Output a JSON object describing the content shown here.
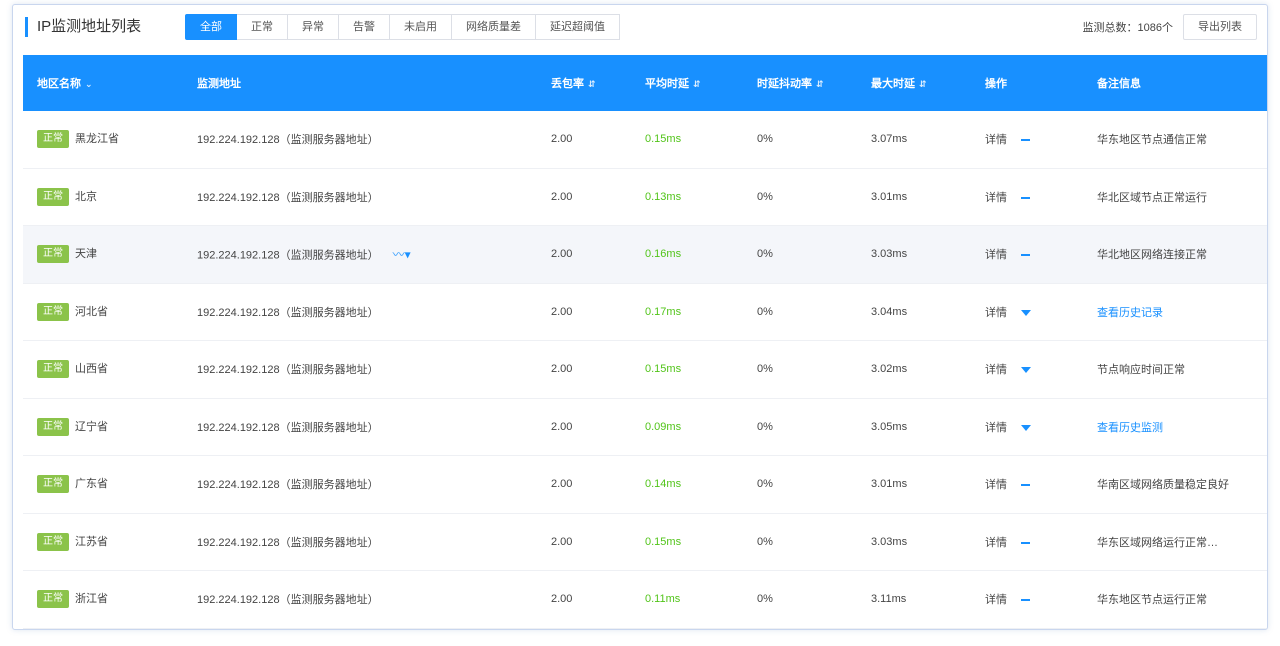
{
  "header": {
    "title": "IP监测地址列表",
    "tabs": [
      "全部",
      "正常",
      "异常",
      "告警",
      "未启用",
      "网络质量差",
      "延迟超阈值"
    ],
    "active_tab": 0,
    "right_label": "监测总数：1086个",
    "right_button": "导出列表"
  },
  "table": {
    "columns": [
      "地区名称",
      "监测地址",
      "丢包率",
      "平均时延",
      "时延抖动率",
      "最大时延",
      "操作",
      "备注信息"
    ],
    "rows": [
      {
        "tag": "正常",
        "region": "黑龙江省",
        "address": "192.224.192.128（监测服务器地址）",
        "loss": "2.00",
        "avg": "0.15ms",
        "jitter": "0%",
        "max": "3.07ms",
        "op": "详情",
        "op_icon": "dash",
        "note": "华东地区节点通信正常",
        "note_link": false,
        "chart": false
      },
      {
        "tag": "正常",
        "region": "北京",
        "address": "192.224.192.128（监测服务器地址）",
        "loss": "2.00",
        "avg": "0.13ms",
        "jitter": "0%",
        "max": "3.01ms",
        "op": "详情",
        "op_icon": "dash",
        "note": "华北区域节点正常运行",
        "note_link": false,
        "chart": false
      },
      {
        "tag": "正常",
        "region": "天津",
        "address": "192.224.192.128（监测服务器地址）",
        "loss": "2.00",
        "avg": "0.16ms",
        "jitter": "0%",
        "max": "3.03ms",
        "op": "详情",
        "op_icon": "dash",
        "note": "华北地区网络连接正常",
        "note_link": false,
        "chart": true
      },
      {
        "tag": "正常",
        "region": "河北省",
        "address": "192.224.192.128（监测服务器地址）",
        "loss": "2.00",
        "avg": "0.17ms",
        "jitter": "0%",
        "max": "3.04ms",
        "op": "详情",
        "op_icon": "tri",
        "note": "查看历史记录",
        "note_link": true,
        "chart": false
      },
      {
        "tag": "正常",
        "region": "山西省",
        "address": "192.224.192.128（监测服务器地址）",
        "loss": "2.00",
        "avg": "0.15ms",
        "jitter": "0%",
        "max": "3.02ms",
        "op": "详情",
        "op_icon": "tri",
        "note": "节点响应时间正常",
        "note_link": false,
        "chart": false
      },
      {
        "tag": "正常",
        "region": "辽宁省",
        "address": "192.224.192.128（监测服务器地址）",
        "loss": "2.00",
        "avg": "0.09ms",
        "jitter": "0%",
        "max": "3.05ms",
        "op": "详情",
        "op_icon": "tri",
        "note": "查看历史监测",
        "note_link": true,
        "chart": false
      },
      {
        "tag": "正常",
        "region": "广东省",
        "address": "192.224.192.128（监测服务器地址）",
        "loss": "2.00",
        "avg": "0.14ms",
        "jitter": "0%",
        "max": "3.01ms",
        "op": "详情",
        "op_icon": "dash",
        "note": "华南区域网络质量稳定良好",
        "note_link": false,
        "chart": false
      },
      {
        "tag": "正常",
        "region": "江苏省",
        "address": "192.224.192.128（监测服务器地址）",
        "loss": "2.00",
        "avg": "0.15ms",
        "jitter": "0%",
        "max": "3.03ms",
        "op": "详情",
        "op_icon": "dash",
        "note": "华东区域网络运行正常…",
        "note_link": false,
        "chart": false
      },
      {
        "tag": "正常",
        "region": "浙江省",
        "address": "192.224.192.128（监测服务器地址）",
        "loss": "2.00",
        "avg": "0.11ms",
        "jitter": "0%",
        "max": "3.11ms",
        "op": "详情",
        "op_icon": "dash",
        "note": "华东地区节点运行正常",
        "note_link": false,
        "chart": false
      }
    ]
  },
  "colors": {
    "accent": "#1890ff",
    "tag_green": "#8bc34a",
    "value_green": "#52c41a"
  }
}
